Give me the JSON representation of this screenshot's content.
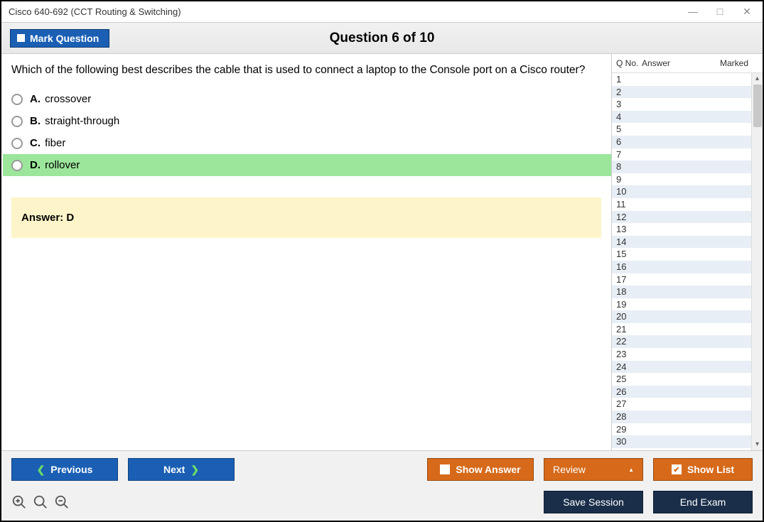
{
  "window": {
    "title": "Cisco 640-692 (CCT Routing & Switching)"
  },
  "header": {
    "mark_label": "Mark Question",
    "counter": "Question 6 of 10"
  },
  "question": {
    "text": "Which of the following best describes the cable that is used to connect a laptop to the Console port on a Cisco router?",
    "options": [
      {
        "letter": "A.",
        "text": "crossover",
        "selected": false
      },
      {
        "letter": "B.",
        "text": "straight-through",
        "selected": false
      },
      {
        "letter": "C.",
        "text": "fiber",
        "selected": false
      },
      {
        "letter": "D.",
        "text": "rollover",
        "selected": true
      }
    ],
    "answer": "Answer: D"
  },
  "sidebar": {
    "headers": {
      "qno": "Q No.",
      "answer": "Answer",
      "marked": "Marked"
    },
    "rows": [
      1,
      2,
      3,
      4,
      5,
      6,
      7,
      8,
      9,
      10,
      11,
      12,
      13,
      14,
      15,
      16,
      17,
      18,
      19,
      20,
      21,
      22,
      23,
      24,
      25,
      26,
      27,
      28,
      29,
      30
    ]
  },
  "footer": {
    "previous": "Previous",
    "next": "Next",
    "show_answer": "Show Answer",
    "review": "Review",
    "show_list": "Show List",
    "save_session": "Save Session",
    "end_exam": "End Exam"
  }
}
